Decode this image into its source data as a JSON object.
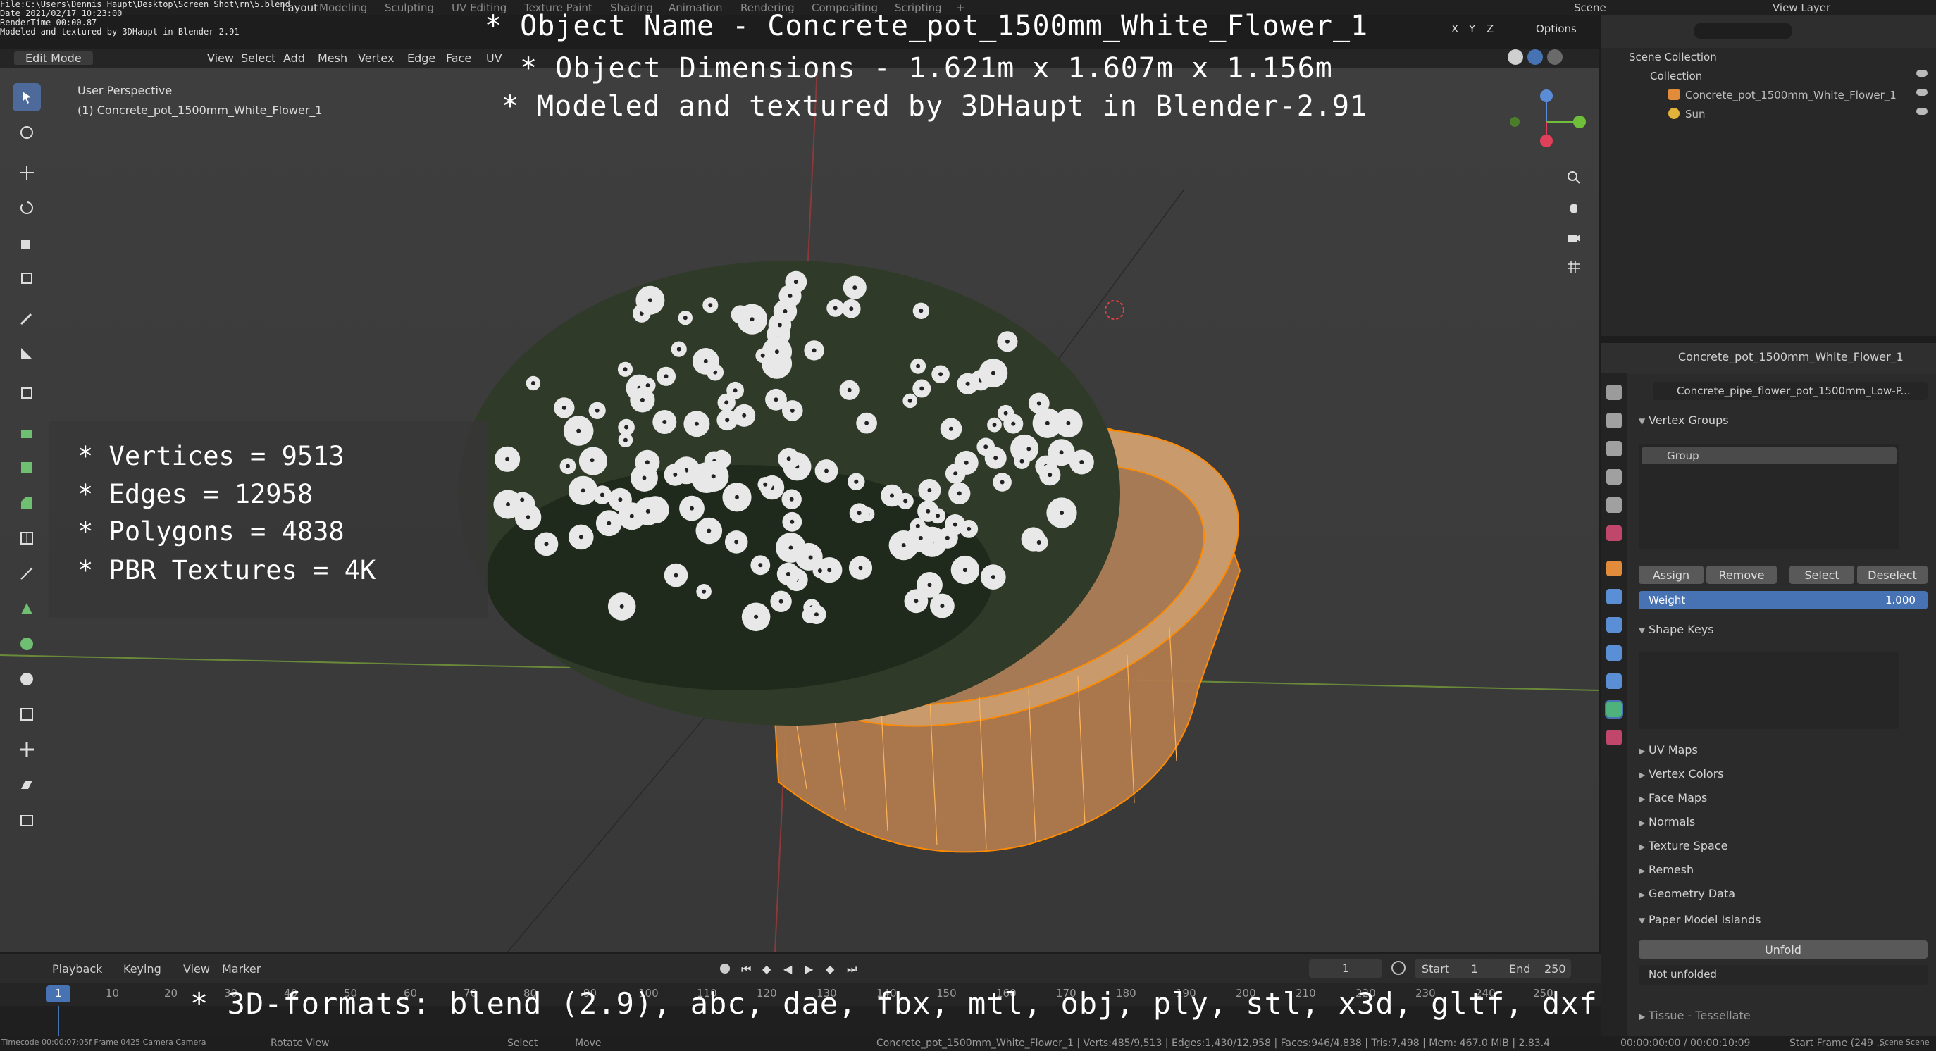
{
  "meta_overlay": {
    "file": "File:C:\\Users\\Dennis Haupt\\Desktop\\Screen Shot\\rn\\5.blend",
    "date": "Date 2021/02/17 10:23:00",
    "render_time": "RenderTime 00:00.87",
    "note": "Modeled and textured by 3DHaupt in Blender-2.91"
  },
  "workspace_tabs": [
    "Layout",
    "Modeling",
    "Sculpting",
    "UV Editing",
    "Texture Paint",
    "Shading",
    "Animation",
    "Rendering",
    "Compositing",
    "Scripting"
  ],
  "topbar": {
    "scene": "Scene",
    "view_layer": "View Layer"
  },
  "viewport_header": {
    "mode": "Edit Mode",
    "menus": [
      "View",
      "Select",
      "Add",
      "Mesh",
      "Vertex",
      "Edge",
      "Face",
      "UV"
    ],
    "axes": [
      "X",
      "Y",
      "Z"
    ],
    "options": "Options"
  },
  "viewport": {
    "perspective": "User Perspective",
    "object_label": "(1) Concrete_pot_1500mm_White_Flower_1"
  },
  "overlay": {
    "line1": "* Object Name - Concrete_pot_1500mm_White_Flower_1",
    "line2": "* Object Dimensions -  1.621m x 1.607m x 1.156m",
    "line3": "* Modeled and textured by 3DHaupt in Blender-2.91",
    "stats": [
      "* Vertices = 9513",
      "* Edges = 12958",
      "* Polygons = 4838",
      "* PBR Textures = 4K"
    ],
    "formats": "* 3D-formats: blend (2.9), abc, dae, fbx, mtl, obj, ply, stl, x3d, gltf, dxf"
  },
  "outliner": {
    "root": "Scene Collection",
    "collection": "Collection",
    "items": [
      "Concrete_pot_1500mm_White_Flower_1",
      "Sun"
    ]
  },
  "properties": {
    "object_name": "Concrete_pot_1500mm_White_Flower_1",
    "mesh_name": "Concrete_pipe_flower_pot_1500mm_Low-P...",
    "vertex_groups": "Vertex Groups",
    "group_item": "Group",
    "buttons": {
      "assign": "Assign",
      "remove": "Remove",
      "select": "Select",
      "deselect": "Deselect"
    },
    "weight_label": "Weight",
    "weight_value": "1.000",
    "shape_keys": "Shape Keys",
    "collapsed_sections": [
      "UV Maps",
      "Vertex Colors",
      "Face Maps",
      "Normals",
      "Texture Space",
      "Remesh",
      "Geometry Data"
    ],
    "paper_model": "Paper Model Islands",
    "unfold": "Unfold",
    "not_unfolded": "Not unfolded",
    "tissue": "Tissue - Tessellate"
  },
  "timeline": {
    "menus": [
      "Playback",
      "Keying",
      "View",
      "Marker"
    ],
    "current_frame": "1",
    "start_label": "Start",
    "start": "1",
    "end_label": "End",
    "end": "250",
    "ruler": [
      "1",
      "10",
      "20",
      "30",
      "40",
      "50",
      "60",
      "70",
      "80",
      "90",
      "100",
      "110",
      "120",
      "130",
      "140",
      "150",
      "160",
      "170",
      "180",
      "190",
      "200",
      "210",
      "220",
      "230",
      "240",
      "250"
    ]
  },
  "statusbar": {
    "left": "Timecode 00:00:07:05f  Frame 0425  Camera Camera",
    "rotate": "Rotate View",
    "select": "Select",
    "move": "Move",
    "stats": "Concrete_pot_1500mm_White_Flower_1 | Verts:485/9,513 | Edges:1,430/12,958 | Faces:946/4,838 | Tris:7,498 | Mem: 467.0 MiB | 2.83.4",
    "right": "00:00:00:00 / 00:00:10:09",
    "start_frame": "Start Frame (249 ...",
    "scene_label": "Scene Scene"
  },
  "colors": {
    "accent": "#4772b3",
    "selection": "#ff8a00",
    "pot": "#c99a6c",
    "flower": "#e8e8e8"
  }
}
